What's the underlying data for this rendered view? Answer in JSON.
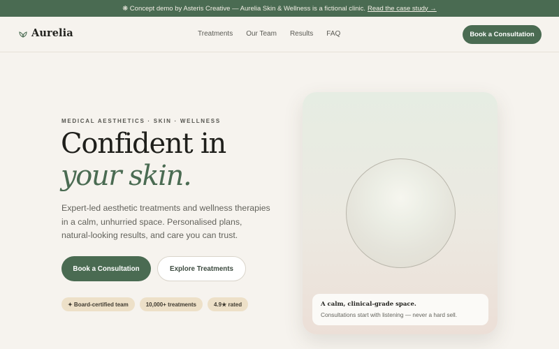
{
  "banner": {
    "text": "❋ Concept demo by Asteris Creative — Aurelia Skin & Wellness is a fictional clinic.",
    "link": "Read the case study →"
  },
  "nav": {
    "logo_icon": "leaf-icon",
    "logo": "Aurelia",
    "links": [
      "Treatments",
      "Our Team",
      "Results",
      "FAQ"
    ],
    "cta": "Book a Consultation"
  },
  "hero": {
    "eyebrow": "MEDICAL AESTHETICS · SKIN · WELLNESS",
    "headline_line1": "Confident in",
    "headline_line2": "your skin.",
    "lede": "Expert-led aesthetic treatments and wellness therapies in a calm, unhurried space. Personalised plans, natural-looking results, and care you can trust.",
    "primary_button": "Book a Consultation",
    "secondary_button": "Explore Treatments",
    "badges": [
      "✦ Board-certified team",
      "10,000+ treatments",
      "4.9★ rated"
    ]
  },
  "visual": {
    "caption_title": "A calm, clinical-grade space.",
    "caption_text": "Consultations start with listening — never a hard sell."
  },
  "colors": {
    "brand_green": "#4a6b52",
    "background": "#f6f3ee",
    "badge": "#ede0c8"
  }
}
